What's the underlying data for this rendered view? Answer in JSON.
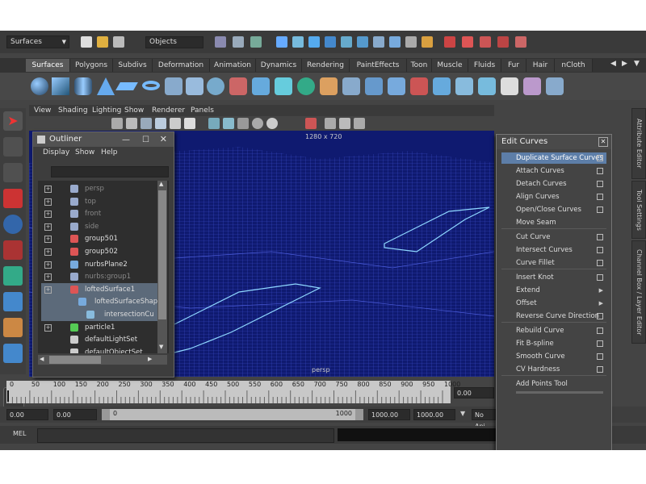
{
  "status_line": {
    "menu_set": "Surfaces",
    "selection_mode": "Objects"
  },
  "shelf_tabs": [
    "Surfaces",
    "Polygons",
    "Subdivs",
    "Deformation",
    "Animation",
    "Dynamics",
    "Rendering",
    "PaintEffects",
    "Toon",
    "Muscle",
    "Fluids",
    "Fur",
    "Hair",
    "nCloth"
  ],
  "panel_menu": [
    "View",
    "Shading",
    "Lighting",
    "Show",
    "Renderer",
    "Panels"
  ],
  "viewport": {
    "resolution": "1280 x 720",
    "camera_label": "persp"
  },
  "outliner": {
    "title": "Outliner",
    "menu": [
      "Display",
      "Show",
      "Help"
    ],
    "items": [
      {
        "label": "persp",
        "dim": true
      },
      {
        "label": "top",
        "dim": true
      },
      {
        "label": "front",
        "dim": true
      },
      {
        "label": "side",
        "dim": true
      },
      {
        "label": "group501",
        "dim": false
      },
      {
        "label": "group502",
        "dim": false
      },
      {
        "label": "nurbsPlane2",
        "dim": false
      },
      {
        "label": "nurbs:group1",
        "dim": true
      },
      {
        "label": "loftedSurface1",
        "dim": false
      },
      {
        "label": "loftedSurfaceShap",
        "dim": false
      },
      {
        "label": "intersectionCu",
        "dim": false
      },
      {
        "label": "particle1",
        "dim": false
      },
      {
        "label": "defaultLightSet",
        "dim": false
      },
      {
        "label": "defaultObjectSet",
        "dim": false
      }
    ]
  },
  "edit_curves": {
    "title": "Edit Curves",
    "items": [
      {
        "label": "Duplicate Surface Curves",
        "kind": "opt"
      },
      {
        "label": "Attach Curves",
        "kind": "opt"
      },
      {
        "label": "Detach Curves",
        "kind": "opt"
      },
      {
        "label": "Align Curves",
        "kind": "opt"
      },
      {
        "label": "Open/Close Curves",
        "kind": "opt"
      },
      {
        "label": "Move Seam",
        "kind": "none"
      },
      {
        "label": "Cut Curve",
        "kind": "opt"
      },
      {
        "label": "Intersect Curves",
        "kind": "opt"
      },
      {
        "label": "Curve Fillet",
        "kind": "opt"
      },
      {
        "label": "Insert Knot",
        "kind": "opt"
      },
      {
        "label": "Extend",
        "kind": "sub"
      },
      {
        "label": "Offset",
        "kind": "sub"
      },
      {
        "label": "Reverse Curve Direction",
        "kind": "opt"
      },
      {
        "label": "Rebuild Curve",
        "kind": "opt"
      },
      {
        "label": "Fit B-spline",
        "kind": "opt"
      },
      {
        "label": "Smooth Curve",
        "kind": "opt"
      },
      {
        "label": "CV Hardness",
        "kind": "opt"
      },
      {
        "label": "Add Points Tool",
        "kind": "none"
      }
    ]
  },
  "right_tabs": [
    "Attribute Editor",
    "Tool Settings",
    "Channel Box / Layer Editor"
  ],
  "timeline": {
    "ticks": [
      "0",
      "50",
      "100",
      "150",
      "200",
      "250",
      "300",
      "350",
      "400",
      "450",
      "500",
      "550",
      "600",
      "650",
      "700",
      "750",
      "800",
      "850",
      "900",
      "950",
      "1000"
    ],
    "current_frame": "0.00"
  },
  "range": {
    "start": "0.00",
    "start2": "0.00",
    "slider_start": "0",
    "slider_end": "1000",
    "end": "1000.00",
    "end2": "1000.00",
    "anim_layer": "No Ani"
  },
  "command_line": {
    "label": "MEL"
  }
}
